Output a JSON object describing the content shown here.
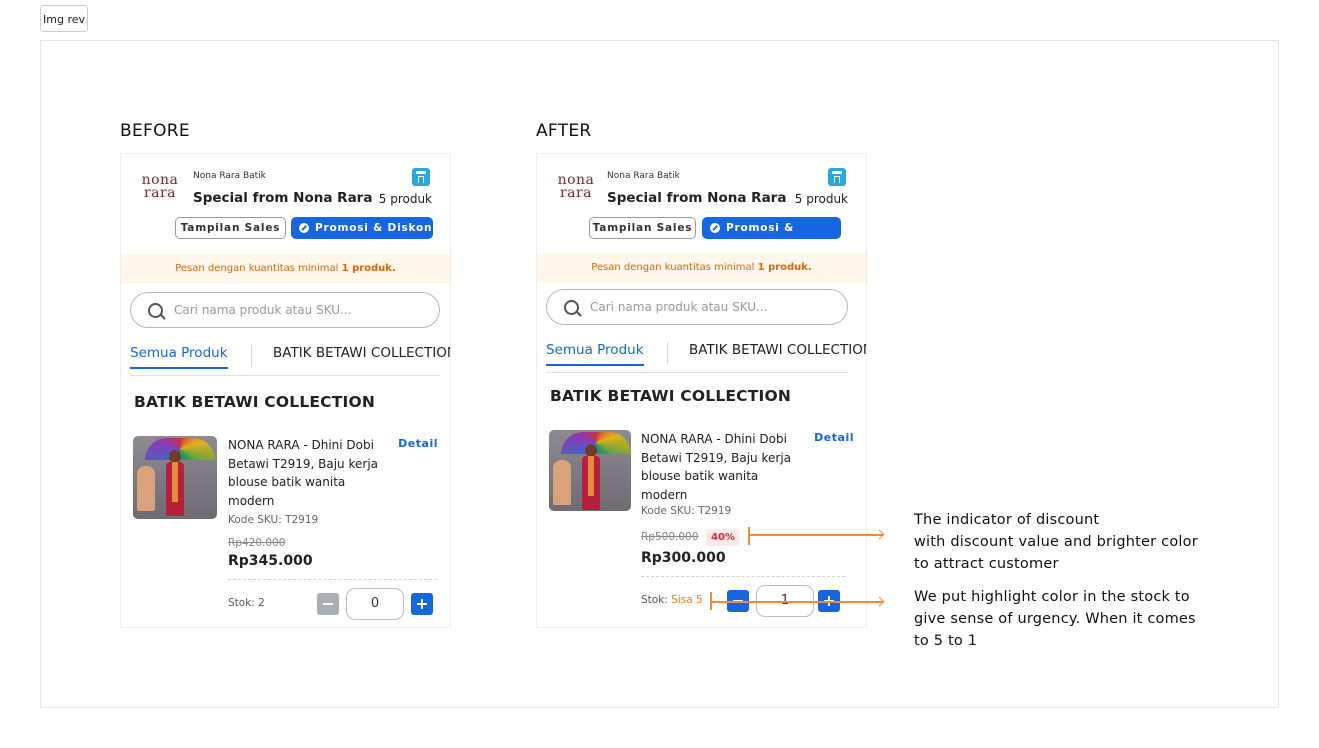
{
  "top_tab": {
    "label": "Img rev"
  },
  "before": {
    "heading": "BEFORE",
    "card": {
      "shop_name": "Nona Rara Batik",
      "logo_text": "nona rara",
      "title": "Special from Nona Rara",
      "product_count": "5 produk",
      "btn_sales": "Tampilan Sales",
      "btn_promo": "Promosi & Diskon",
      "notice_prefix": "Pesan dengan kuantitas minimal ",
      "notice_qty": "1 produk.",
      "search_placeholder": "Cari nama produk atau SKU...",
      "tab_all": "Semua Produk",
      "tab_collection": "BATIK BETAWI COLLECTION",
      "collection_title": "BATIK BETAWI COLLECTION",
      "product_name": "NONA RARA - Dhini Dobi Betawi T2919, Baju kerja blouse batik wanita modern",
      "detail": "Detail",
      "sku": "Kode SKU: T2919",
      "old_price": "Rp420.000",
      "price": "Rp345.000",
      "stock_label": "Stok: ",
      "stock_value": "2",
      "qty": "0"
    }
  },
  "after": {
    "heading": "AFTER",
    "card": {
      "shop_name": "Nona Rara Batik",
      "logo_text": "nona rara",
      "title": "Special from Nona Rara",
      "product_count": "5 produk",
      "btn_sales": "Tampilan Sales",
      "btn_promo": "Promosi & Diskon",
      "notice_prefix": "Pesan dengan kuantitas minimal ",
      "notice_qty": "1 produk.",
      "search_placeholder": "Cari nama produk atau SKU...",
      "tab_all": "Semua Produk",
      "tab_collection": "BATIK BETAWI COLLECTION",
      "collection_title": "BATIK BETAWI COLLECTION",
      "product_name": "NONA RARA - Dhini Dobi Betawi T2919, Baju kerja blouse batik wanita modern",
      "detail": "Detail",
      "sku": "Kode SKU: T2919",
      "old_price": "Rp500.000",
      "discount": "40%",
      "price": "Rp300.000",
      "stock_label": "Stok: ",
      "stock_value": "Sisa 5",
      "qty": "1"
    }
  },
  "annotations": {
    "discount": [
      "The indicator of discount",
      "with discount value and brighter color",
      "to attract customer"
    ],
    "stock": [
      "We put highlight color in the stock to",
      "give sense of urgency. When it comes",
      "to 5 to 1"
    ]
  },
  "colors": {
    "primary_blue": "#1666e0",
    "notice_orange": "#e0660e",
    "urgent_orange": "#f07a1a",
    "discount_red": "#e0283c",
    "annotation_orange": "#f08a3c",
    "minus_disabled": "#a9aeb5"
  }
}
